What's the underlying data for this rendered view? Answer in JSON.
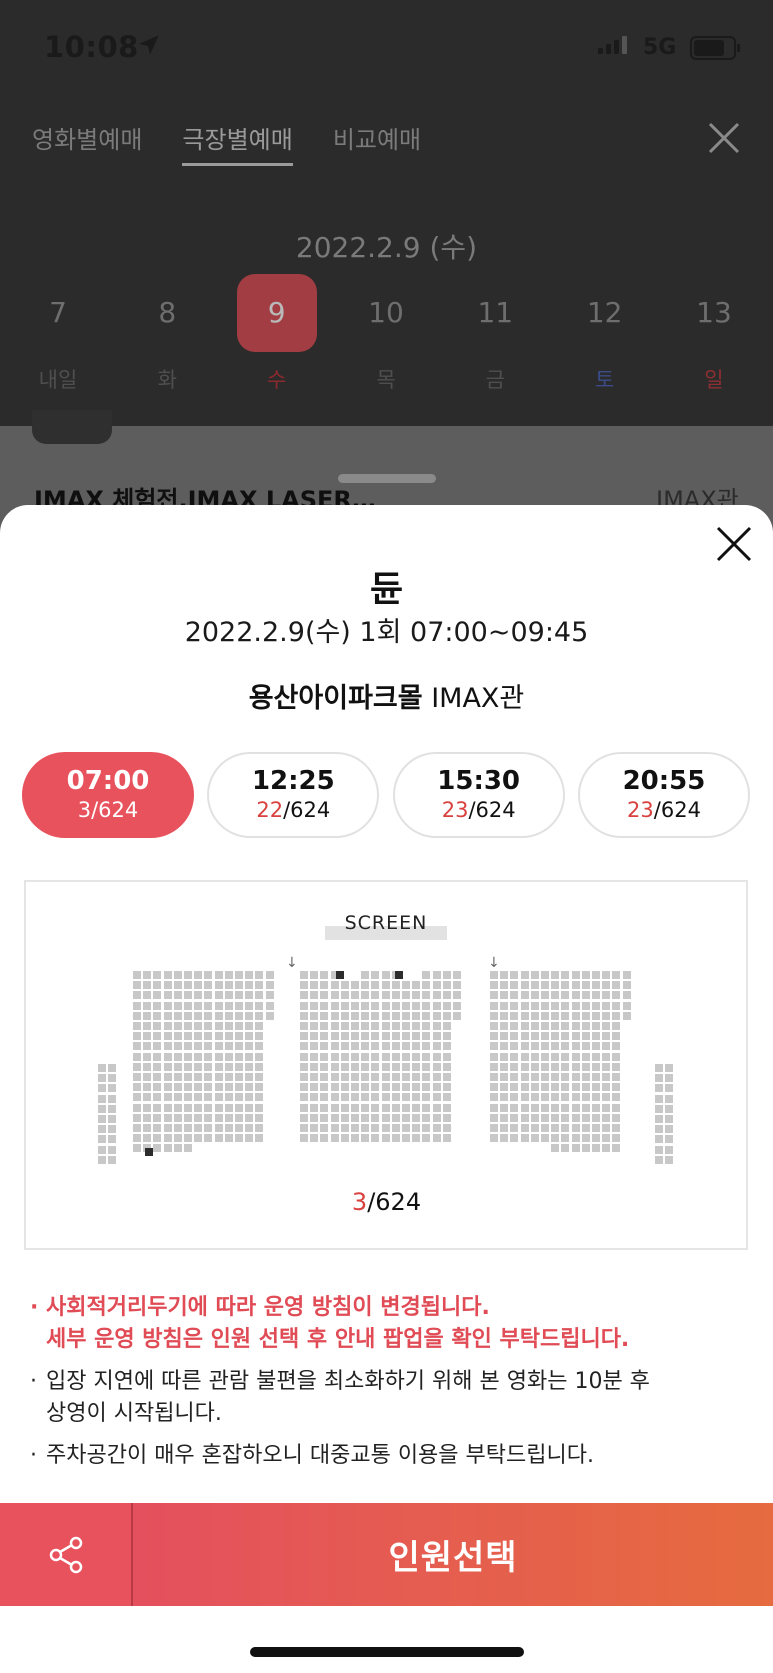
{
  "status_bar": {
    "time": "10:08",
    "network": "5G"
  },
  "header": {
    "tabs": [
      {
        "label": "영화별예매",
        "active": false
      },
      {
        "label": "극장별예매",
        "active": true
      },
      {
        "label": "비교예매",
        "active": false
      }
    ],
    "close_icon": "close-icon"
  },
  "date_picker": {
    "label": "2022.2.9 (수)",
    "days": [
      {
        "num": "7",
        "name": "내일",
        "style": "normal"
      },
      {
        "num": "8",
        "name": "화",
        "style": "normal"
      },
      {
        "num": "9",
        "name": "수",
        "style": "selected"
      },
      {
        "num": "10",
        "name": "목",
        "style": "normal"
      },
      {
        "num": "11",
        "name": "금",
        "style": "normal"
      },
      {
        "num": "12",
        "name": "토",
        "style": "saturday"
      },
      {
        "num": "13",
        "name": "일",
        "style": "sunday"
      }
    ]
  },
  "background_list": {
    "title": "IMAX 체험전,IMAX LASER…",
    "screen": "IMAX관"
  },
  "sheet": {
    "movie_title": "듄",
    "showtime": "2022.2.9(수) 1회 07:00~09:45",
    "theater_name": "용산아이파크몰",
    "screen_name": "IMAX관",
    "times": [
      {
        "time": "07:00",
        "remaining": "3",
        "total": "/624",
        "active": true
      },
      {
        "time": "12:25",
        "remaining": "22",
        "total": "/624",
        "active": false
      },
      {
        "time": "15:30",
        "remaining": "23",
        "total": "/624",
        "active": false
      },
      {
        "time": "20:55",
        "remaining": "23",
        "total": "/624",
        "active": false
      }
    ],
    "seatmap": {
      "screen_label": "SCREEN",
      "remaining": "3",
      "total": "/624",
      "aisle_marker": "↓"
    },
    "notices": [
      {
        "text": "사회적거리두기에 따라 운영 방침이 변경됩니다.\n세부 운영 방침은 인원 선택 후 안내 팝업을 확인 부탁드립니다.",
        "warn": true
      },
      {
        "text": "입장 지연에 따른 관람 불편을 최소화하기 위해 본 영화는 10분 후\n상영이 시작됩니다.",
        "warn": false
      },
      {
        "text": "주차공간이 매우 혼잡하오니 대중교통 이용을 부탁드립니다.",
        "warn": false
      }
    ]
  },
  "bottom_bar": {
    "share_icon": "share-icon",
    "select_label": "인원선택"
  },
  "colors": {
    "accent": "#e8525d",
    "gradient_end": "#e66b3f",
    "remaining_red": "#d9413f"
  }
}
